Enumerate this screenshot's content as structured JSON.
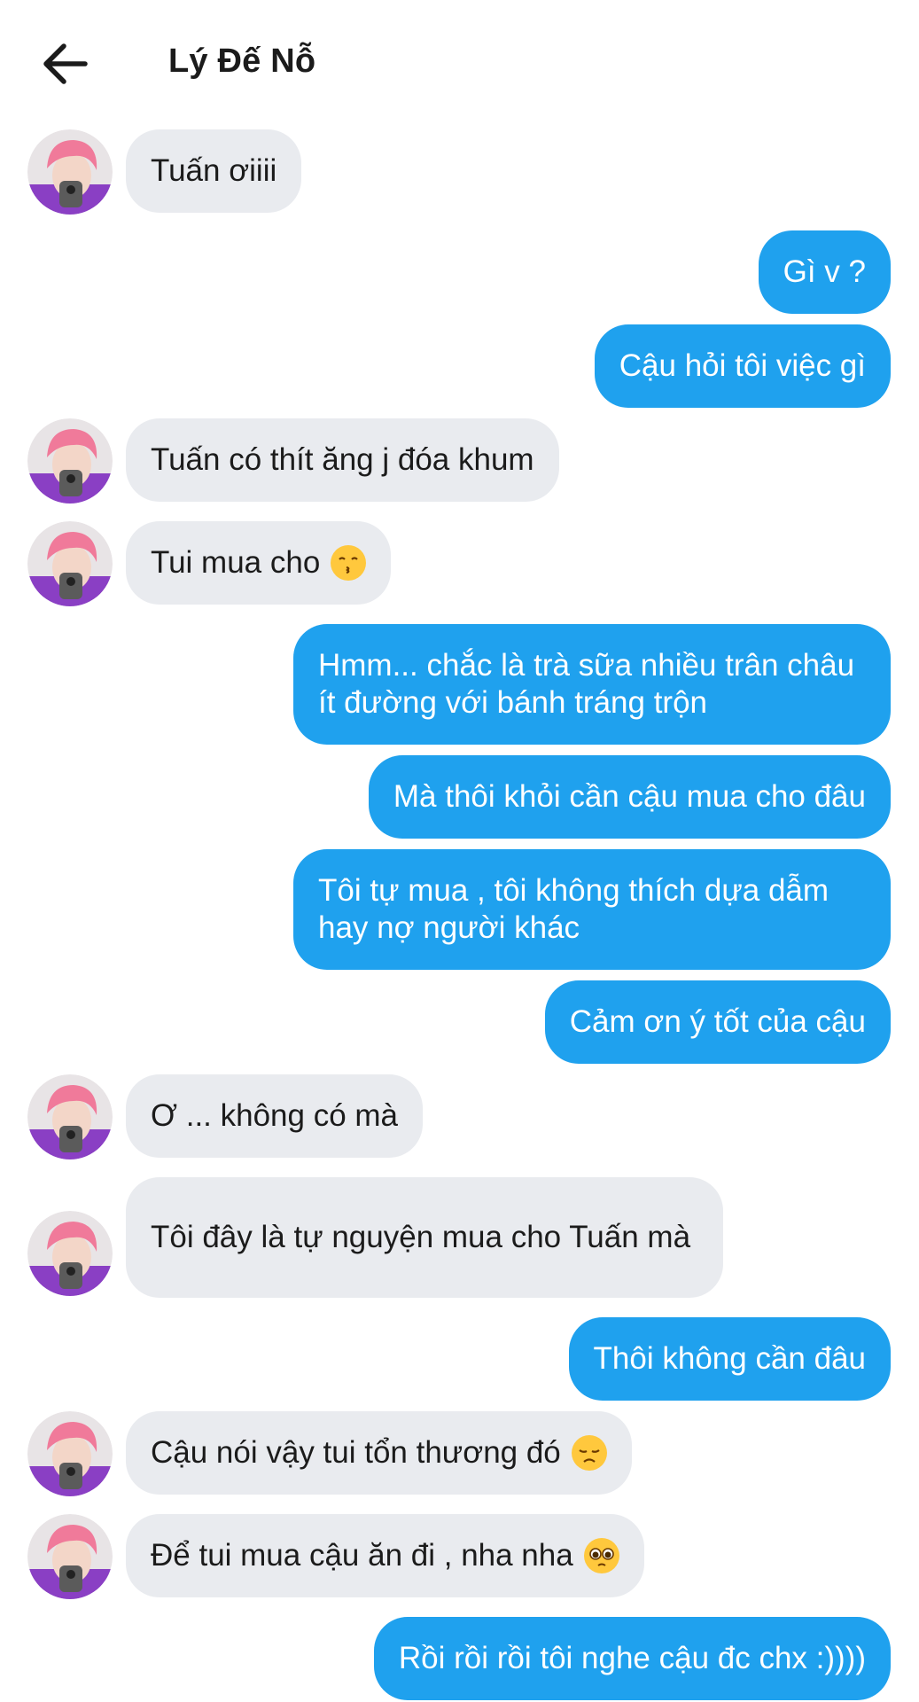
{
  "header": {
    "title": "Lý Đế Nỗ",
    "back_icon": "arrow-left-icon"
  },
  "messages": [
    {
      "sender": "them",
      "text": "Tuấn ơiiii"
    },
    {
      "sender": "me",
      "text": "Gì v ?"
    },
    {
      "sender": "me",
      "text": "Cậu hỏi tôi việc gì"
    },
    {
      "sender": "them",
      "text": "Tuấn có thít ăng j đóa khum"
    },
    {
      "sender": "them",
      "text": "Tui mua cho",
      "emoji": "kissing-face-icon"
    },
    {
      "sender": "me",
      "text": "Hmm... chắc là trà sữa nhiều trân châu ít đường với bánh tráng trộn"
    },
    {
      "sender": "me",
      "text": "Mà thôi khỏi cần cậu mua cho đâu"
    },
    {
      "sender": "me",
      "text": "Tôi tự mua , tôi không thích dựa dẫm hay nợ người khác"
    },
    {
      "sender": "me",
      "text": "Cảm ơn ý tốt của cậu"
    },
    {
      "sender": "them",
      "text": "Ơ ... không có mà"
    },
    {
      "sender": "them",
      "text": "Tôi đây là tự nguyện mua cho Tuấn mà"
    },
    {
      "sender": "me",
      "text": "Thôi không cần đâu"
    },
    {
      "sender": "them",
      "text": "Cậu nói vậy tui tổn thương đó",
      "emoji": "disappointed-face-icon"
    },
    {
      "sender": "them",
      "text": "Để tui mua cậu ăn đi , nha nha",
      "emoji": "pleading-face-icon"
    },
    {
      "sender": "me",
      "text": "Rồi rồi rồi tôi nghe cậu đc chx :))))"
    }
  ],
  "colors": {
    "outgoing": "#1fa1ee",
    "incoming": "#e9ebef",
    "avatar_hair": "#f07a9a",
    "avatar_shirt": "#8a3fc4"
  }
}
